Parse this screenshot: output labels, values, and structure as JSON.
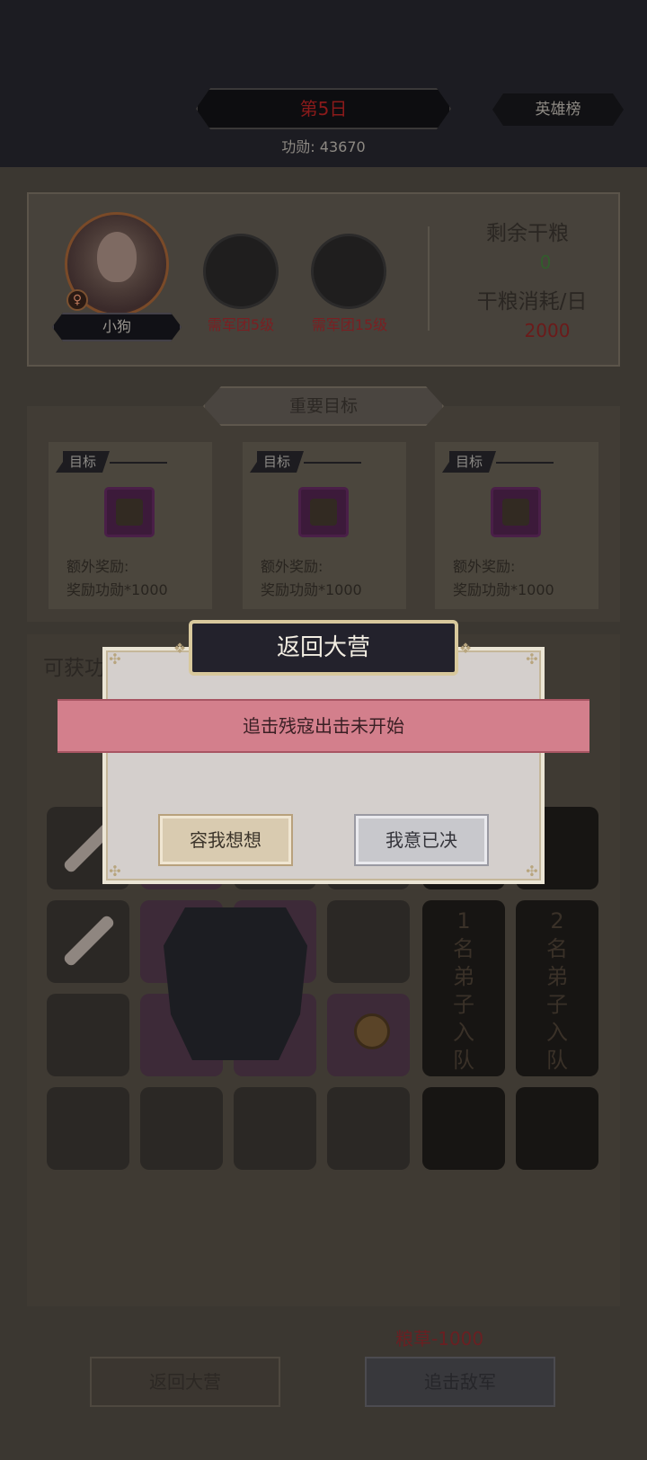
{
  "header": {
    "day_label": "第5日",
    "hero_rank_button": "英雄榜",
    "merit": "功勋: 43670"
  },
  "player": {
    "name": "小狗",
    "gender_symbol": "♀",
    "slots": [
      {
        "caption": "需军团5级"
      },
      {
        "caption": "需军团15级"
      }
    ]
  },
  "supplies": {
    "remaining_label": "剩余干粮",
    "remaining_value": "0",
    "consumption_label": "干粮消耗/日",
    "consumption_value": "2000"
  },
  "goals": {
    "header": "重要目标",
    "cards": [
      {
        "tag": "目标",
        "item_icon": "armor-icon",
        "reward_label": "额外奖励:",
        "reward_value": "奖励功勋*1000"
      },
      {
        "tag": "目标",
        "item_icon": "helmet-icon",
        "reward_label": "额外奖励:",
        "reward_value": "奖励功勋*1000"
      },
      {
        "tag": "目标",
        "item_icon": "scroll-icon",
        "reward_label": "额外奖励:",
        "reward_value": "奖励功勋*1000"
      }
    ]
  },
  "loot": {
    "title_partial": "可获功",
    "recruit_slots": [
      "1名弟子入队",
      "2名弟子入队"
    ]
  },
  "footer": {
    "cost": "粮草-1000",
    "back_button": "返回大营",
    "pursue_button": "追击敌军"
  },
  "dialog": {
    "title": "返回大营",
    "message": "追击残寇出击未开始",
    "cancel_button": "容我想想",
    "confirm_button": "我意已决"
  }
}
